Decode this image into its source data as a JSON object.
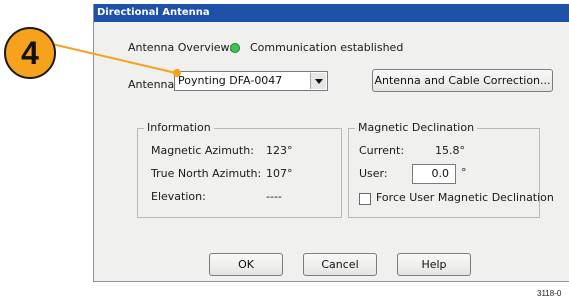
{
  "window": {
    "title": "Directional Antenna"
  },
  "overview": {
    "label": "Antenna Overview:",
    "status": "Communication established",
    "status_color": "#39c84a"
  },
  "antenna": {
    "label": "Antenna:",
    "selected": "Poynting DFA-0047"
  },
  "buttons": {
    "correction": "Antenna and Cable Correction...",
    "ok": "OK",
    "cancel": "Cancel",
    "help": "Help"
  },
  "information": {
    "title": "Information",
    "rows": [
      {
        "label": "Magnetic Azimuth:",
        "value": "123°"
      },
      {
        "label": "True North Azimuth:",
        "value": "107°"
      },
      {
        "label": "Elevation:",
        "value": "----"
      }
    ]
  },
  "declination": {
    "title": "Magnetic Declination",
    "current_label": "Current:",
    "current_value": "15.8°",
    "user_label": "User:",
    "user_value": "0.0",
    "user_unit": "°",
    "force_label": "Force User Magnetic Declination",
    "force_checked": false
  },
  "callout": {
    "number": "4"
  },
  "figure_id": "3118-0"
}
